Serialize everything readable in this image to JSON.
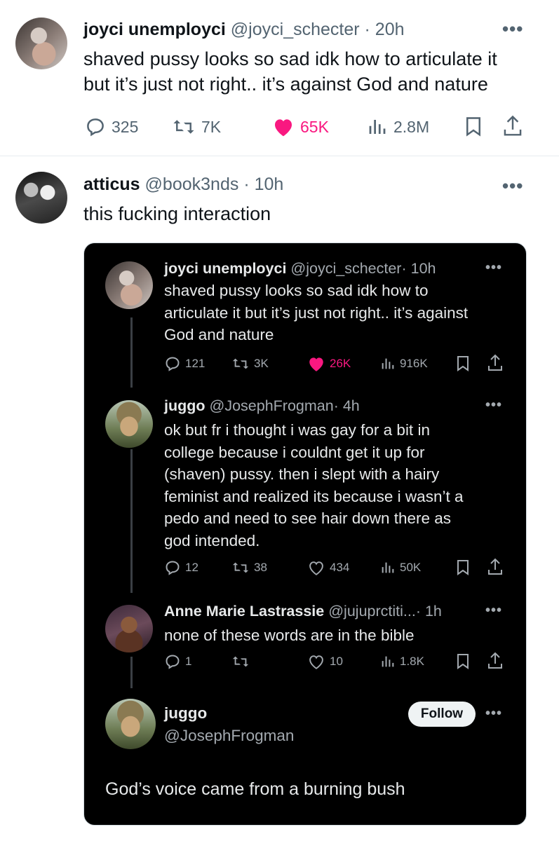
{
  "tweet1": {
    "name": "joyci unemployci",
    "handle": "@joyci_schecter",
    "time": "· 20h",
    "text_lines": [
      "shaved pussy looks so sad idk how to articulate it",
      "but it’s just not right.. it’s against God and nature"
    ],
    "replies": "325",
    "reposts": "7K",
    "likes": "65K",
    "views": "2.8M",
    "liked": true
  },
  "tweet2": {
    "name": "atticus",
    "handle": "@book3nds",
    "time": "· 10h",
    "text": "this fucking interaction"
  },
  "embedded": {
    "post1": {
      "name": "joyci unemployci",
      "handle": "@joyci_schecter",
      "time": "· 10h",
      "text_lines": [
        "shaved pussy looks so sad idk how to",
        "articulate it but it’s just not right.. it’s against",
        "God and nature"
      ],
      "replies": "121",
      "reposts": "3K",
      "likes": "26K",
      "views": "916K"
    },
    "post2": {
      "name": "juggo",
      "handle": "@JosephFrogman",
      "time": "· 4h",
      "text_lines": [
        "ok but fr i thought i was gay for a bit in",
        "college because i couldnt get it up for",
        "(shaven) pussy. then i slept with a hairy",
        "feminist and realized its because i wasn’t a",
        "pedo and need to see hair down there as",
        "god intended."
      ],
      "replies": "12",
      "reposts": "38",
      "likes": "434",
      "views": "50K"
    },
    "post3": {
      "name": "Anne Marie Lastrassie",
      "handle": "@jujuprctiti...",
      "time": "· 1h",
      "text": "none of these words are in the bible",
      "replies": "1",
      "reposts": "",
      "likes": "10",
      "views": "1.8K"
    },
    "post4": {
      "name": "juggo",
      "handle": "@JosephFrogman",
      "follow_label": "Follow",
      "text": "God’s voice came from a burning bush"
    }
  },
  "colors": {
    "like_pink": "#f91880",
    "muted": "#536471",
    "dark_bg": "#000000"
  }
}
